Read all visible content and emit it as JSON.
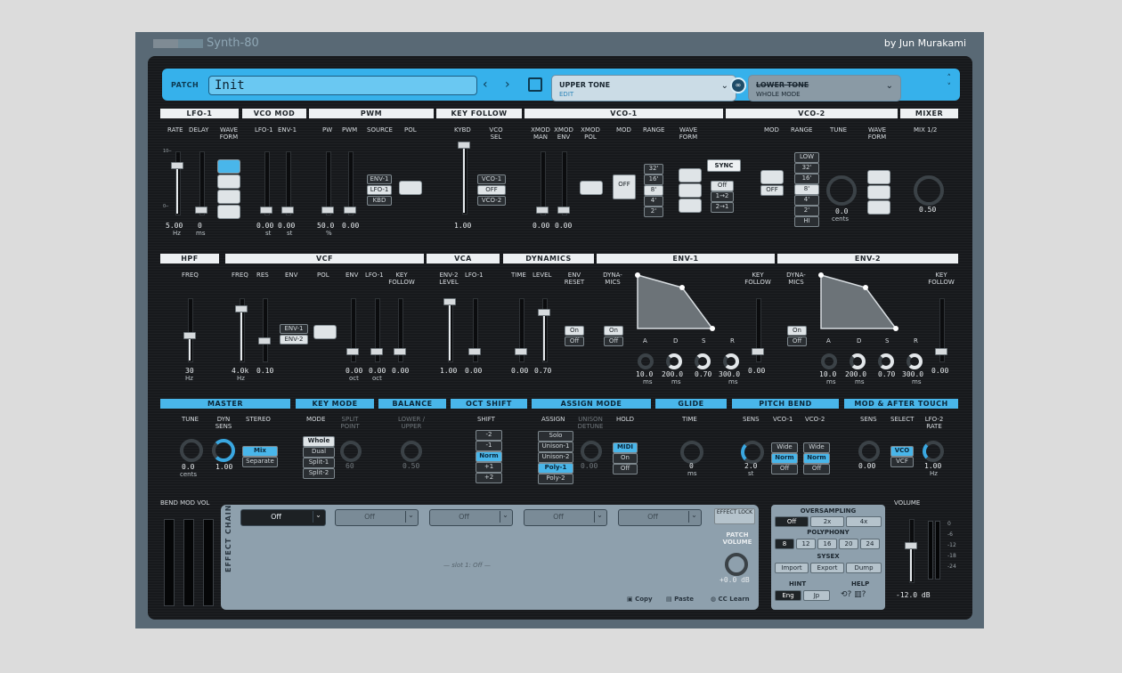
{
  "app": {
    "title": "Synth-80",
    "byline": "by Jun Murakami"
  },
  "patch": {
    "label": "PATCH",
    "name": "Init",
    "upper_title": "UPPER TONE",
    "upper_sub": "EDIT",
    "lower_title": "LOWER TONE",
    "lower_sub": "WHOLE MODE"
  },
  "sections": {
    "lfo1": "LFO-1",
    "vcomod": "VCO MOD",
    "pwm": "PWM",
    "keyfollow": "KEY FOLLOW",
    "vco1": "VCO-1",
    "vco2": "VCO-2",
    "mixer": "MIXER",
    "hpf": "HPF",
    "vcf": "VCF",
    "vca": "VCA",
    "dynamics": "DYNAMICS",
    "env1": "ENV-1",
    "env2": "ENV-2",
    "master": "MASTER",
    "keymode": "KEY MODE",
    "balance": "BALANCE",
    "octshift": "OCT SHIFT",
    "assignmode": "ASSIGN MODE",
    "glide": "GLIDE",
    "pitchbend": "PITCH BEND",
    "modafter": "MOD & AFTER TOUCH"
  },
  "row1": {
    "lfo1": {
      "l1": "RATE",
      "l2": "DELAY",
      "l3": "WAVE FORM",
      "v1": "5.00",
      "u1": "Hz",
      "v2": "0",
      "u2": "ms"
    },
    "vcomod": {
      "l1": "LFO-1",
      "l2": "ENV-1",
      "v1": "0.00",
      "u1": "st",
      "v2": "0.00",
      "u2": "st"
    },
    "pwm": {
      "l1": "PW",
      "l2": "PWM",
      "l3": "SOURCE",
      "l4": "POL",
      "v1": "50.0",
      "u1": "%",
      "v2": "0.00",
      "opts": [
        "ENV-1",
        "LFO-1",
        "KBD"
      ]
    },
    "keyfollow": {
      "l1": "KYBD",
      "l2": "VCO SEL",
      "v1": "1.00",
      "opts": [
        "VCO-1",
        "OFF",
        "VCO-2"
      ]
    },
    "vco1": {
      "l1": "XMOD MAN",
      "l2": "XMOD ENV",
      "l3": "XMOD POL",
      "l4": "MOD",
      "l5": "RANGE",
      "l6": "WAVE FORM",
      "v1": "0.00",
      "v2": "0.00",
      "mod": "OFF",
      "range": [
        "32'",
        "16'",
        "8'",
        "4'",
        "2'"
      ],
      "sync": "SYNC",
      "sync_opts": [
        "Off",
        "1→2",
        "2→1"
      ]
    },
    "vco2": {
      "l1": "MOD",
      "l2": "RANGE",
      "l3": "TUNE",
      "l4": "WAVE FORM",
      "mod": "OFF",
      "range": [
        "LOW",
        "32'",
        "16'",
        "8'",
        "4'",
        "2'",
        "HI"
      ],
      "tune_val": "0.0",
      "tune_unit": "cents"
    },
    "mixer": {
      "l1": "MIX 1/2",
      "v1": "0.50"
    }
  },
  "row2": {
    "hpf": {
      "l1": "FREQ",
      "v1": "30",
      "u1": "Hz"
    },
    "vcf": {
      "l1": "FREQ",
      "l2": "RES",
      "l3": "ENV",
      "l4": "POL",
      "l5": "ENV",
      "l6": "LFO-1",
      "l7": "KEY FOLLOW",
      "v1": "4.0k",
      "u1": "Hz",
      "v2": "0.10",
      "v3": "0.00",
      "u3": "oct",
      "v4": "0.00",
      "u4": "oct",
      "v5": "0.00",
      "opts": [
        "ENV-1",
        "ENV-2"
      ]
    },
    "vca": {
      "l1": "ENV-2 LEVEL",
      "l2": "LFO-1",
      "v1": "1.00",
      "v2": "0.00"
    },
    "dynamics": {
      "l1": "TIME",
      "l2": "LEVEL",
      "l3": "ENV RESET",
      "v1": "0.00",
      "v2": "0.70",
      "opts": [
        "On",
        "Off"
      ]
    },
    "env1": {
      "l1": "DYNA-MICS",
      "l2": "KEY FOLLOW",
      "opts": [
        "On",
        "Off"
      ],
      "a": "A",
      "d": "D",
      "s": "S",
      "r": "R",
      "av": "10.0",
      "au": "ms",
      "dv": "200.0",
      "du": "ms",
      "sv": "0.70",
      "rv": "300.0",
      "ru": "ms",
      "kv": "0.00"
    },
    "env2": {
      "l1": "DYNA-MICS",
      "l2": "KEY FOLLOW",
      "opts": [
        "On",
        "Off"
      ],
      "a": "A",
      "d": "D",
      "s": "S",
      "r": "R",
      "av": "10.0",
      "au": "ms",
      "dv": "200.0",
      "du": "ms",
      "sv": "0.70",
      "rv": "300.0",
      "ru": "ms",
      "kv": "0.00"
    }
  },
  "row3": {
    "master": {
      "l1": "TUNE",
      "l2": "DYN SENS",
      "l3": "STEREO",
      "v1": "0.0",
      "u1": "cents",
      "v2": "1.00",
      "opts": [
        "Mix",
        "Separate"
      ]
    },
    "keymode": {
      "l1": "MODE",
      "l2": "SPLIT POINT",
      "v2": "60",
      "opts": [
        "Whole",
        "Dual",
        "Split-1",
        "Split-2"
      ]
    },
    "balance": {
      "l1": "LOWER / UPPER",
      "v1": "0.50"
    },
    "octshift": {
      "l1": "SHIFT",
      "opts": [
        "-2",
        "-1",
        "Norm",
        "+1",
        "+2"
      ]
    },
    "assignmode": {
      "l1": "ASSIGN",
      "l2": "UNISON DETUNE",
      "l3": "HOLD",
      "v2": "0.00",
      "opts": [
        "Solo",
        "Unison-1",
        "Unison-2",
        "Poly-1",
        "Poly-2"
      ],
      "hold": [
        "MIDI",
        "On",
        "Off"
      ]
    },
    "glide": {
      "l1": "TIME",
      "v1": "0",
      "u1": "ms"
    },
    "pitchbend": {
      "l1": "SENS",
      "l2": "VCO-1",
      "l3": "VCO-2",
      "v1": "2.0",
      "u1": "st",
      "opts1": [
        "Wide",
        "Norm",
        "Off"
      ],
      "opts2": [
        "Wide",
        "Norm",
        "Off"
      ]
    },
    "modafter": {
      "l1": "SENS",
      "l2": "SELECT",
      "l3": "LFO-2 RATE",
      "v1": "0.00",
      "v3": "1.00",
      "u3": "Hz",
      "opts": [
        "VCO",
        "VCF"
      ]
    }
  },
  "bottom": {
    "bendmodvol": "BEND MOD VOL",
    "effect_label": "EFFECT CHAIN",
    "slots": [
      "Off",
      "Off",
      "Off",
      "Off",
      "Off"
    ],
    "empty": "— slot 1: Off —",
    "copy": "Copy",
    "paste": "Paste",
    "cclearn": "CC Learn",
    "effect_lock": "EFFECT LOCK",
    "patch_volume": "PATCH VOLUME",
    "patch_volume_val": "+0.0 dB",
    "oversampling": "OVERSAMPLING",
    "os_opts": [
      "Off",
      "2x",
      "4x"
    ],
    "polyphony": "POLYPHONY",
    "poly_opts": [
      "8",
      "12",
      "16",
      "20",
      "24"
    ],
    "sysex": "SYSEX",
    "sysex_opts": [
      "Import",
      "Export",
      "Dump"
    ],
    "hint": "HINT",
    "hint_opts": [
      "Eng",
      "Jp"
    ],
    "help": "HELP",
    "volume": "VOLUME",
    "volume_val": "-12.0 dB",
    "vol_scale": [
      "0",
      "-6",
      "-12",
      "-18",
      "-24"
    ]
  }
}
